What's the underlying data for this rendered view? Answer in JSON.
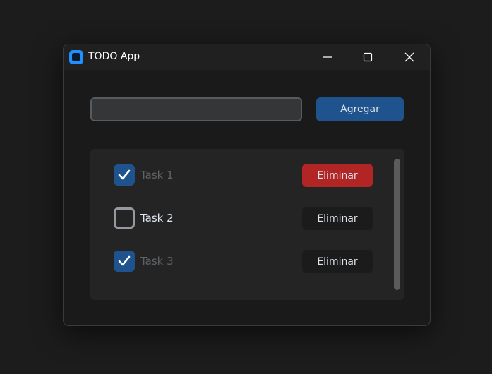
{
  "window": {
    "title": "TODO App"
  },
  "input": {
    "value": "",
    "placeholder": ""
  },
  "add_button": {
    "label": "Agregar"
  },
  "tasks": [
    {
      "label": "Task 1",
      "done": true,
      "delete_label": "Eliminar",
      "delete_hovered": true
    },
    {
      "label": "Task 2",
      "done": false,
      "delete_label": "Eliminar",
      "delete_hovered": false
    },
    {
      "label": "Task 3",
      "done": true,
      "delete_label": "Eliminar",
      "delete_hovered": false
    }
  ],
  "icons": {
    "app": "app-icon",
    "minimize": "minimize-icon",
    "maximize": "maximize-icon",
    "close": "close-icon",
    "check": "checkmark-icon"
  },
  "colors": {
    "accent": "#1f538d",
    "danger_hover": "#b22525",
    "background": "#1a1a1a",
    "frame": "#242424",
    "text": "#dce4ee",
    "done_text": "#5f6366"
  }
}
